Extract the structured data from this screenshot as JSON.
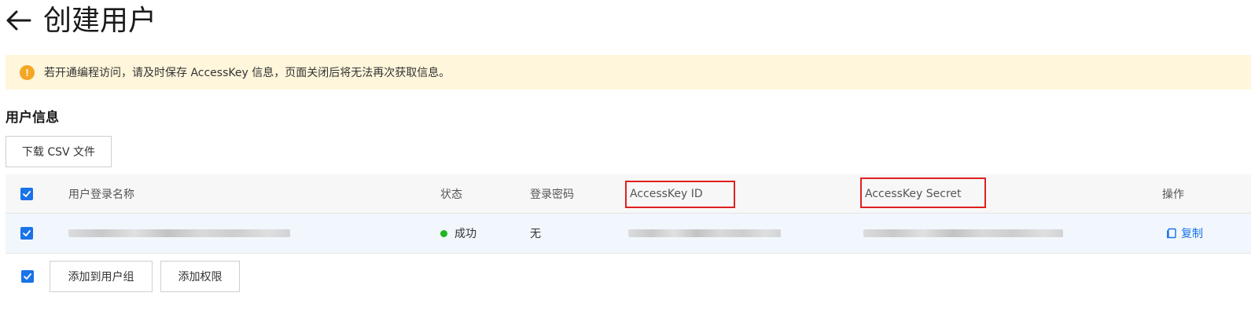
{
  "header": {
    "title": "创建用户"
  },
  "notice": {
    "text": "若开通编程访问，请及时保存 AccessKey 信息，页面关闭后将无法再次获取信息。"
  },
  "section": {
    "title": "用户信息",
    "download_label": "下载 CSV 文件"
  },
  "table": {
    "columns": {
      "login_name": "用户登录名称",
      "status": "状态",
      "password": "登录密码",
      "access_key_id": "AccessKey ID",
      "access_key_secret": "AccessKey Secret",
      "actions": "操作"
    },
    "rows": [
      {
        "status": "成功",
        "password": "无",
        "action_label": "复制"
      }
    ]
  },
  "footer": {
    "add_to_group_label": "添加到用户组",
    "add_permission_label": "添加权限"
  },
  "colors": {
    "accent": "#1a73e8",
    "notice_bg": "#fff6db",
    "warning": "#f5a623",
    "success": "#1fb61f",
    "highlight": "#e02020"
  }
}
